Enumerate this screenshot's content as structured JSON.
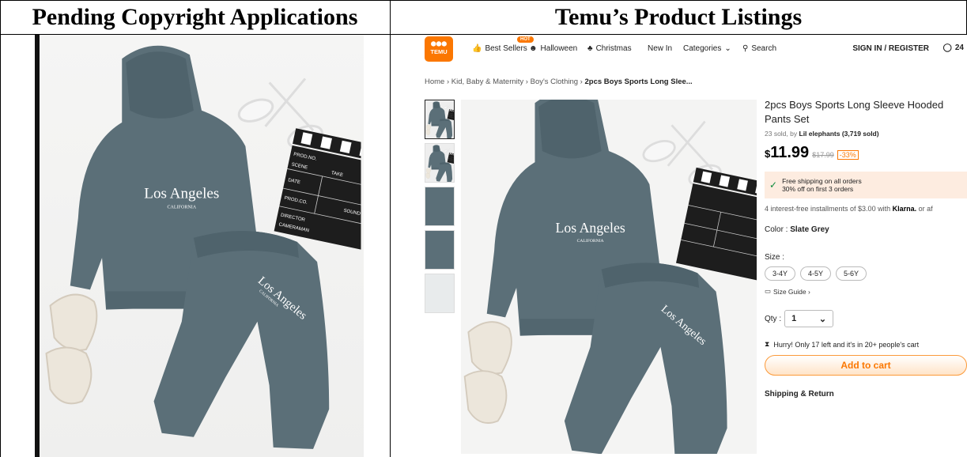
{
  "headers": {
    "left": "Pending Copyright Applications",
    "right": "Temu’s Product Listings"
  },
  "temu": {
    "logo": "TEMU",
    "nav": {
      "best_sellers": "Best Sellers",
      "hot_badge": "HOT",
      "halloween": "Halloween",
      "christmas": "Christmas",
      "new_in": "New In",
      "categories": "Categories",
      "search": "Search",
      "signin": "SIGN IN / REGISTER",
      "cart_count": "24"
    },
    "breadcrumb": {
      "home": "Home",
      "kid": "Kid, Baby & Maternity",
      "boys": "Boy's Clothing",
      "current": "2pcs Boys Sports Long Slee..."
    },
    "product": {
      "title": "2pcs Boys Sports Long Sleeve Hooded Pants Set",
      "sold": "23 sold, by",
      "seller": "Lil elephants (3,719 sold)",
      "currency": "$",
      "price": "11.99",
      "original_price": "$17.99",
      "discount": "-33%",
      "shipping_line1": "Free shipping on all orders",
      "shipping_line2": "30% off on first 3 orders",
      "installments": "4 interest-free installments of $3.00 with",
      "klarna": "Klarna.",
      "installments_tail": "or af",
      "color_label": "Color :",
      "color_value": "Slate Grey",
      "size_label": "Size :",
      "sizes": [
        "3-4Y",
        "4-5Y",
        "5-6Y"
      ],
      "size_guide": "Size Guide ›",
      "qty_label": "Qty :",
      "qty_value": "1",
      "hurry": "Hurry! Only 17 left and it's in 20+ people's cart",
      "add_to_cart": "Add to cart",
      "shipping_return": "Shipping & Return"
    },
    "image_text": {
      "hoodie_main": "Los Angeles",
      "hoodie_sub": "CALIFORNIA",
      "pants_main": "Los Angeles",
      "pants_sub": "CALIFORNIA",
      "clapper_1": "PROD.NO.",
      "clapper_2": "SCENE",
      "clapper_3": "TAKE",
      "clapper_4": "DATE",
      "clapper_5": "PROD.CO.",
      "clapper_6": "SOUND",
      "clapper_7": "DIRECTOR",
      "clapper_8": "CAMERAMAN"
    },
    "colors": {
      "accent": "#fb7701",
      "garment": "#5b6f78",
      "ship_bg": "#fdece0"
    }
  }
}
